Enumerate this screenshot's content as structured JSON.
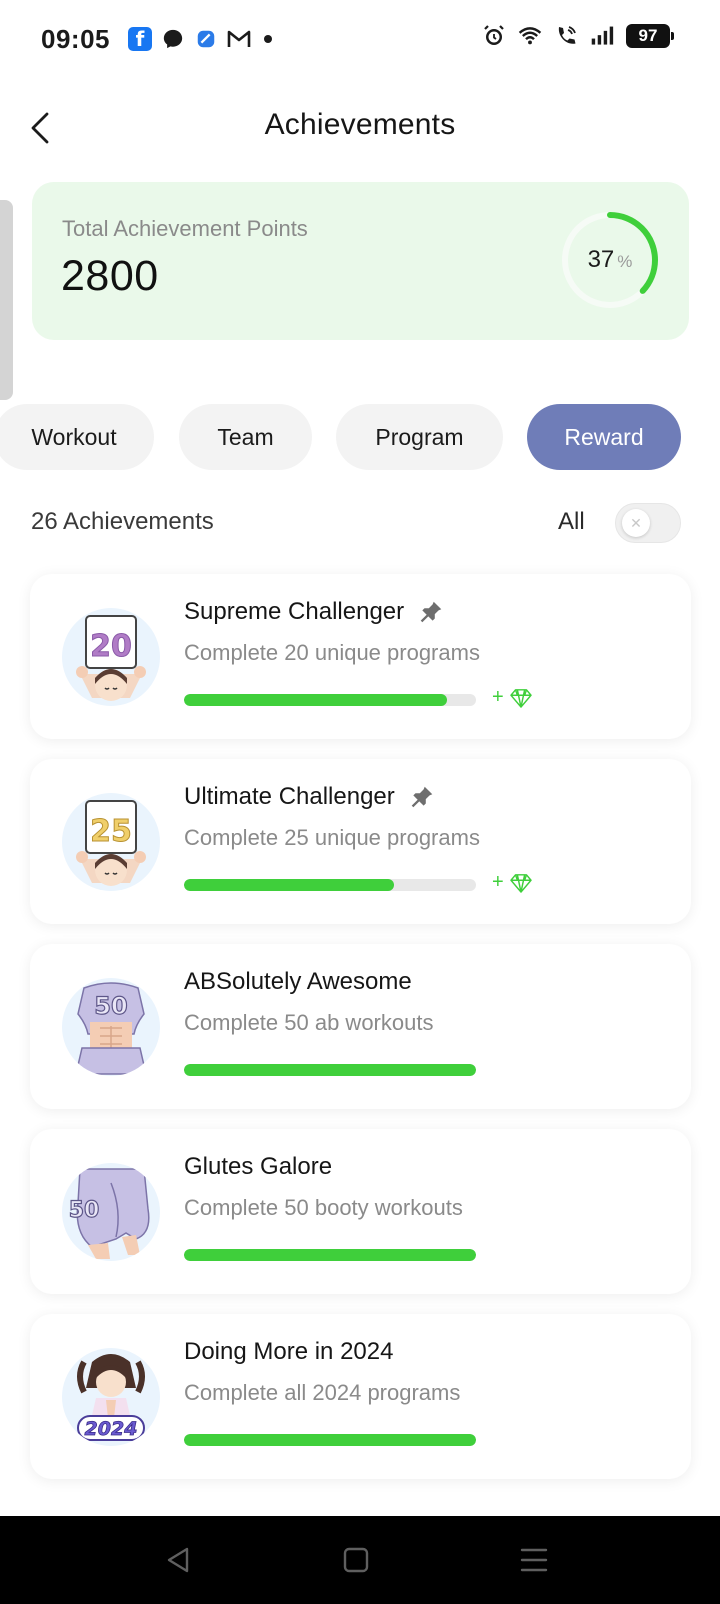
{
  "status_bar": {
    "time": "09:05",
    "battery": "97",
    "left_icons": [
      "facebook-icon",
      "messenger-icon",
      "app-icon",
      "gmail-icon",
      "dot-icon"
    ],
    "right_icons": [
      "alarm-icon",
      "wifi-icon",
      "call-icon",
      "signal-icon",
      "battery-icon"
    ]
  },
  "header": {
    "title": "Achievements",
    "back_icon": "chevron-left-icon"
  },
  "points_card": {
    "label": "Total Achievement Points",
    "value": "2800",
    "progress_value": "37",
    "progress_unit": "%",
    "progress_fraction": 0.37,
    "background": "#eaf9ea",
    "ring_color": "#3fcf3b"
  },
  "tabs": [
    {
      "label": "Workout",
      "active": false
    },
    {
      "label": "Team",
      "active": false
    },
    {
      "label": "Program",
      "active": false
    },
    {
      "label": "Reward",
      "active": true
    }
  ],
  "accent_color": "#6f7db8",
  "list_header": {
    "count_label": "26 Achievements",
    "filter_label": "All",
    "toggle_on": false
  },
  "achievements": [
    {
      "title": "Supreme Challenger",
      "description": "Complete 20 unique programs",
      "badge_text": "20",
      "pinned": true,
      "progress": 0.9,
      "reward": "+"
    },
    {
      "title": "Ultimate Challenger",
      "description": "Complete 25 unique programs",
      "badge_text": "25",
      "pinned": true,
      "progress": 0.72,
      "reward": "+"
    },
    {
      "title": "ABSolutely Awesome",
      "description": "Complete 50 ab workouts",
      "badge_text": "50",
      "pinned": false,
      "progress": 1.0,
      "reward": ""
    },
    {
      "title": "Glutes Galore",
      "description": "Complete 50 booty workouts",
      "badge_text": "50",
      "pinned": false,
      "progress": 1.0,
      "reward": ""
    },
    {
      "title": "Doing More in 2024",
      "description": "Complete all 2024 programs",
      "badge_text": "2024",
      "pinned": false,
      "progress": 1.0,
      "reward": ""
    }
  ],
  "nav_bar": {
    "buttons": [
      "back-triangle-icon",
      "home-square-icon",
      "menu-lines-icon"
    ]
  }
}
